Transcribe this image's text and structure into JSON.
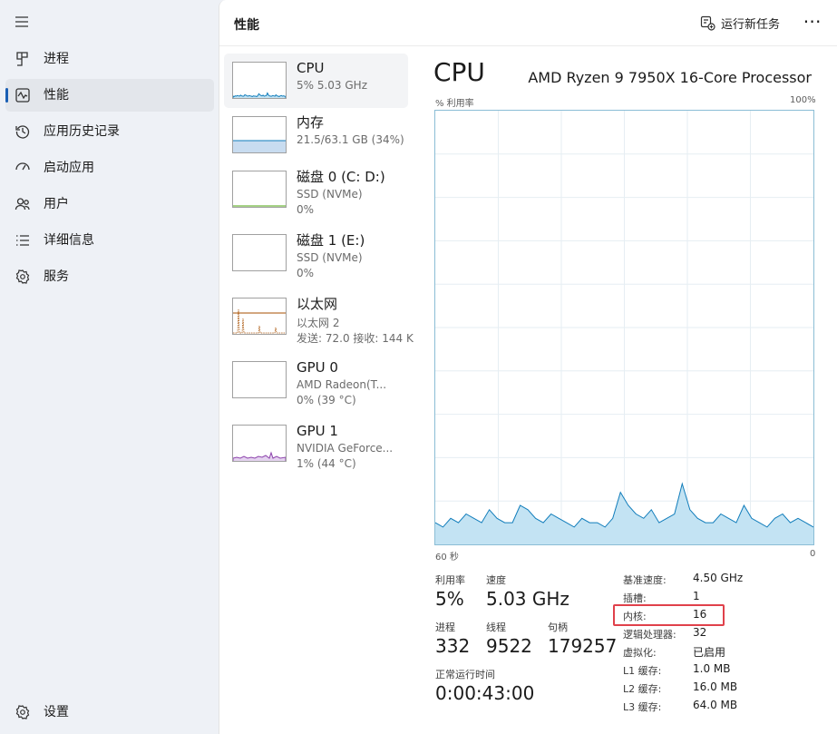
{
  "nav": {
    "items": [
      {
        "label": "进程",
        "icon": "processes-icon"
      },
      {
        "label": "性能",
        "icon": "performance-icon"
      },
      {
        "label": "应用历史记录",
        "icon": "history-icon"
      },
      {
        "label": "启动应用",
        "icon": "startup-icon"
      },
      {
        "label": "用户",
        "icon": "users-icon"
      },
      {
        "label": "详细信息",
        "icon": "details-icon"
      },
      {
        "label": "服务",
        "icon": "services-icon"
      }
    ],
    "settings_label": "设置"
  },
  "header": {
    "title": "性能",
    "run_task_label": "运行新任务",
    "more_label": "⋯"
  },
  "resources": [
    {
      "name": "CPU",
      "sub1": "5% 5.03 GHz",
      "sub2": ""
    },
    {
      "name": "内存",
      "sub1": "21.5/63.1 GB (34%)",
      "sub2": ""
    },
    {
      "name": "磁盘 0 (C: D:)",
      "sub1": "SSD (NVMe)",
      "sub2": "0%"
    },
    {
      "name": "磁盘 1 (E:)",
      "sub1": "SSD (NVMe)",
      "sub2": "0%"
    },
    {
      "name": "以太网",
      "sub1": "以太网 2",
      "sub2": "发送: 72.0 接收: 144 K"
    },
    {
      "name": "GPU 0",
      "sub1": "AMD Radeon(T...",
      "sub2": "0% (39 °C)"
    },
    {
      "name": "GPU 1",
      "sub1": "NVIDIA GeForce...",
      "sub2": "1% (44 °C)"
    }
  ],
  "detail": {
    "title": "CPU",
    "model": "AMD Ryzen 9 7950X 16-Core Processor",
    "graph_y_label": "% 利用率",
    "graph_y_max": "100%",
    "graph_x_left": "60 秒",
    "graph_x_right": "0",
    "utilization_label": "利用率",
    "utilization_value": "5%",
    "speed_label": "速度",
    "speed_value": "5.03 GHz",
    "processes_label": "进程",
    "processes_value": "332",
    "threads_label": "线程",
    "threads_value": "9522",
    "handles_label": "句柄",
    "handles_value": "179257",
    "uptime_label": "正常运行时间",
    "uptime_value": "0:00:43:00",
    "specs": [
      {
        "key": "基准速度:",
        "value": "4.50 GHz"
      },
      {
        "key": "插槽:",
        "value": "1"
      },
      {
        "key": "内核:",
        "value": "16"
      },
      {
        "key": "逻辑处理器:",
        "value": "32"
      },
      {
        "key": "虚拟化:",
        "value": "已启用"
      },
      {
        "key": "L1 缓存:",
        "value": "1.0 MB"
      },
      {
        "key": "L2 缓存:",
        "value": "16.0 MB"
      },
      {
        "key": "L3 缓存:",
        "value": "64.0 MB"
      }
    ]
  },
  "colors": {
    "cpu_line": "#117dbb",
    "cpu_fill": "#c3e3f3",
    "memory_fill": "#c8dcf0",
    "ethernet_line": "#a74f01",
    "gpu_line": "#8e44ad",
    "highlight": "#e0414b",
    "active_bar": "#1a5fb4"
  },
  "cpu_history": [
    5,
    4,
    6,
    5,
    7,
    6,
    5,
    8,
    6,
    5,
    5,
    9,
    8,
    6,
    5,
    7,
    6,
    5,
    4,
    6,
    5,
    5,
    4,
    6,
    12,
    9,
    7,
    6,
    8,
    5,
    6,
    7,
    14,
    8,
    6,
    5,
    5,
    7,
    6,
    5,
    9,
    6,
    5,
    4,
    6,
    7,
    5,
    6,
    5,
    4
  ]
}
